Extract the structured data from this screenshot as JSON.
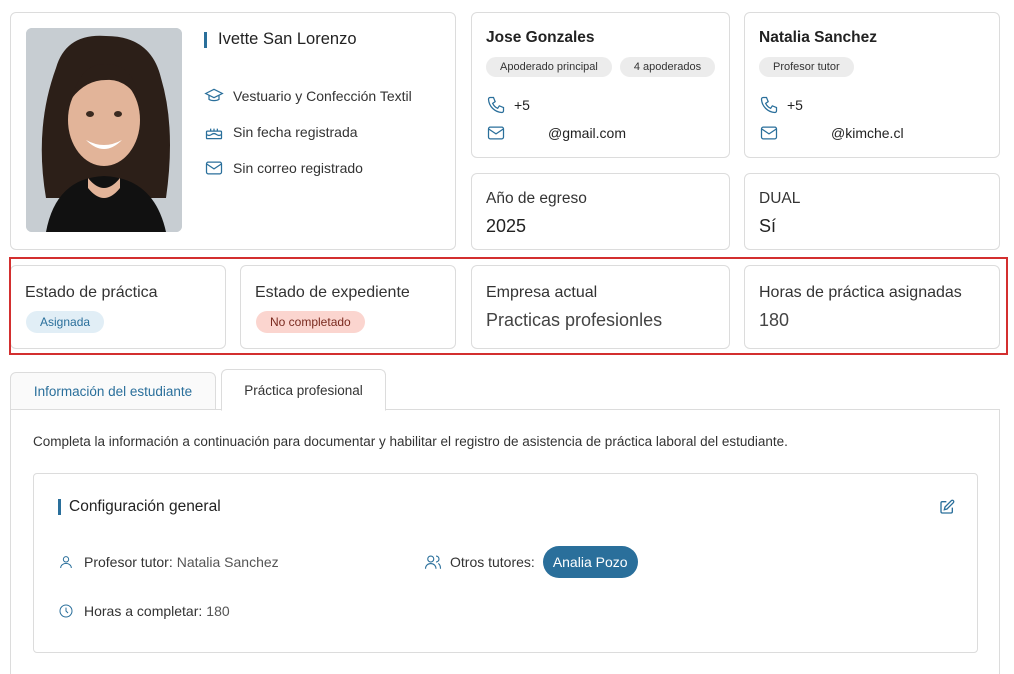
{
  "student": {
    "name": "Ivette San Lorenzo",
    "specialty": "Vestuario y Confección Textil",
    "birthdate": "Sin fecha registrada",
    "email": "Sin correo registrado"
  },
  "guardian": {
    "name": "Jose Gonzales",
    "badges": [
      "Apoderado principal",
      "4 apoderados"
    ],
    "phone": "+5",
    "email": "@gmail.com"
  },
  "tutor_contact": {
    "name": "Natalia Sanchez",
    "badges": [
      "Profesor tutor"
    ],
    "phone": "+5",
    "email": "@kimche.cl"
  },
  "graduation": {
    "label": "Año de egreso",
    "value": "2025"
  },
  "dual": {
    "label": "DUAL",
    "value": "Sí"
  },
  "stats": {
    "practice_state": {
      "label": "Estado de práctica",
      "value": "Asignada"
    },
    "record_state": {
      "label": "Estado de expediente",
      "value": "No completado"
    },
    "company": {
      "label": "Empresa actual",
      "value": "Practicas profesionles"
    },
    "hours": {
      "label": "Horas de práctica asignadas",
      "value": "180"
    }
  },
  "tabs": [
    {
      "label": "Información del estudiante",
      "active": false
    },
    {
      "label": "Práctica profesional",
      "active": true
    }
  ],
  "panel": {
    "description": "Completa la información a continuación para documentar y habilitar el registro de asistencia de práctica laboral del estudiante.",
    "config": {
      "title": "Configuración general",
      "tutor_label": "Profesor tutor:",
      "tutor_value": "Natalia Sanchez",
      "other_tutors_label": "Otros tutores:",
      "other_tutors": [
        "Analia Pozo"
      ],
      "hours_label": "Horas a completar:",
      "hours_value": "180"
    }
  },
  "colors": {
    "accent": "#2a6f9b",
    "highlight_border": "#d32f2f",
    "pill_blue_bg": "#e1eef6",
    "pill_red_bg": "#fbd5cf"
  },
  "icons": {
    "specialty": "graduation-cap-icon",
    "birthdate": "cake-icon",
    "email": "mail-icon",
    "phone": "phone-icon",
    "user": "user-icon",
    "users": "users-icon",
    "clock": "clock-icon",
    "edit": "edit-icon"
  }
}
